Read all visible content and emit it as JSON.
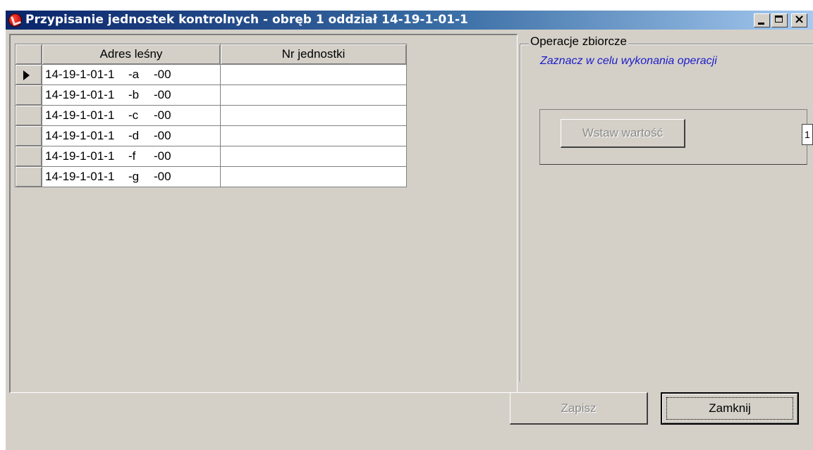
{
  "window": {
    "title": "Przypisanie jednostek kontrolnych - obręb 1 oddział 14-19-1-01-1",
    "icon": "app-icon"
  },
  "grid": {
    "columns": [
      "Adres leśny",
      "Nr jednostki"
    ],
    "rows": [
      {
        "addr": "14-19-1-01-1",
        "sub": "-a",
        "suffix": "-00",
        "nr": "",
        "current": true
      },
      {
        "addr": "14-19-1-01-1",
        "sub": "-b",
        "suffix": "-00",
        "nr": "",
        "current": false
      },
      {
        "addr": "14-19-1-01-1",
        "sub": "-c",
        "suffix": "-00",
        "nr": "",
        "current": false
      },
      {
        "addr": "14-19-1-01-1",
        "sub": "-d",
        "suffix": "-00",
        "nr": "",
        "current": false
      },
      {
        "addr": "14-19-1-01-1",
        "sub": "-f",
        "suffix": "-00",
        "nr": "",
        "current": false
      },
      {
        "addr": "14-19-1-01-1",
        "sub": "-g",
        "suffix": "-00",
        "nr": "",
        "current": false
      }
    ]
  },
  "group": {
    "legend": "Operacje zbiorcze",
    "hint": "Zaznacz w celu wykonania operacji",
    "insert_button": "Wstaw wartość",
    "side_value": "1"
  },
  "footer": {
    "save_label": "Zapisz",
    "close_label": "Zamknij"
  },
  "colors": {
    "title_gradient_start": "#0a246a",
    "title_gradient_end": "#a6caf0",
    "face": "#d4d0c8",
    "hint_text": "#1c1cc8"
  }
}
